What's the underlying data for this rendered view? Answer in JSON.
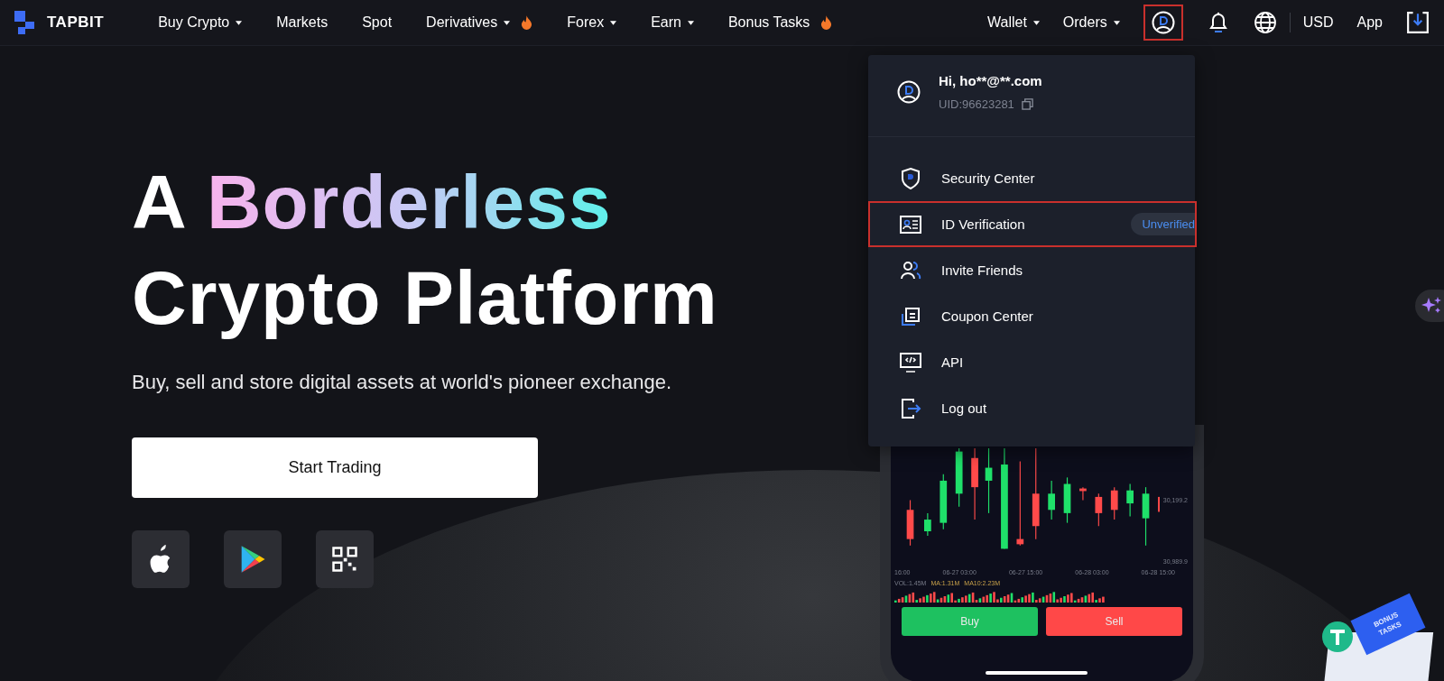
{
  "nav": {
    "logo": "TAPBIT",
    "items": [
      {
        "label": "Buy Crypto",
        "caret": true,
        "hot": false
      },
      {
        "label": "Markets",
        "caret": false,
        "hot": false
      },
      {
        "label": "Spot",
        "caret": false,
        "hot": false
      },
      {
        "label": "Derivatives",
        "caret": true,
        "hot": true
      },
      {
        "label": "Forex",
        "caret": true,
        "hot": false
      },
      {
        "label": "Earn",
        "caret": true,
        "hot": false
      },
      {
        "label": "Bonus Tasks",
        "caret": false,
        "hot": true
      }
    ],
    "right_items": [
      {
        "label": "Wallet",
        "caret": true
      },
      {
        "label": "Orders",
        "caret": true
      }
    ],
    "account_highlighted": true,
    "currency": "USD",
    "app": "App"
  },
  "hero": {
    "title_start": "A",
    "title_highlight": "Borderless",
    "title_line2": "Crypto Platform",
    "subtitle": "Buy, sell and store digital assets at world's pioneer exchange.",
    "cta": "Start Trading",
    "stores": [
      {
        "kind": "apple"
      },
      {
        "kind": "play"
      },
      {
        "kind": "qr"
      }
    ]
  },
  "account_menu": {
    "greeting": "Hi, ho**@**.com",
    "uid": "UID:96623281",
    "items": [
      {
        "kind": "security",
        "label": "Security Center",
        "highlighted": false
      },
      {
        "kind": "id",
        "label": "ID Verification",
        "badge": "Unverified",
        "highlighted": true
      },
      {
        "kind": "invite",
        "label": "Invite Friends",
        "highlighted": false
      },
      {
        "kind": "coupon",
        "label": "Coupon Center",
        "highlighted": false
      },
      {
        "kind": "api",
        "label": "API",
        "highlighted": false
      },
      {
        "kind": "logout",
        "label": "Log out",
        "highlighted": false
      }
    ]
  },
  "phone": {
    "price_labels": [
      "30,199.2",
      "30,989.9"
    ],
    "time_labels": [
      "16:00",
      "06-27 03:00",
      "06-27 15:00",
      "06-28 03:00",
      "06-28 15:00"
    ],
    "volume_labels": [
      "VOL:1.45M",
      "MA:1.31M",
      "MA10:2.23M"
    ],
    "buy": "Buy",
    "sell": "Sell"
  },
  "bonus_widget": {
    "label": "BONUS TASKS"
  }
}
